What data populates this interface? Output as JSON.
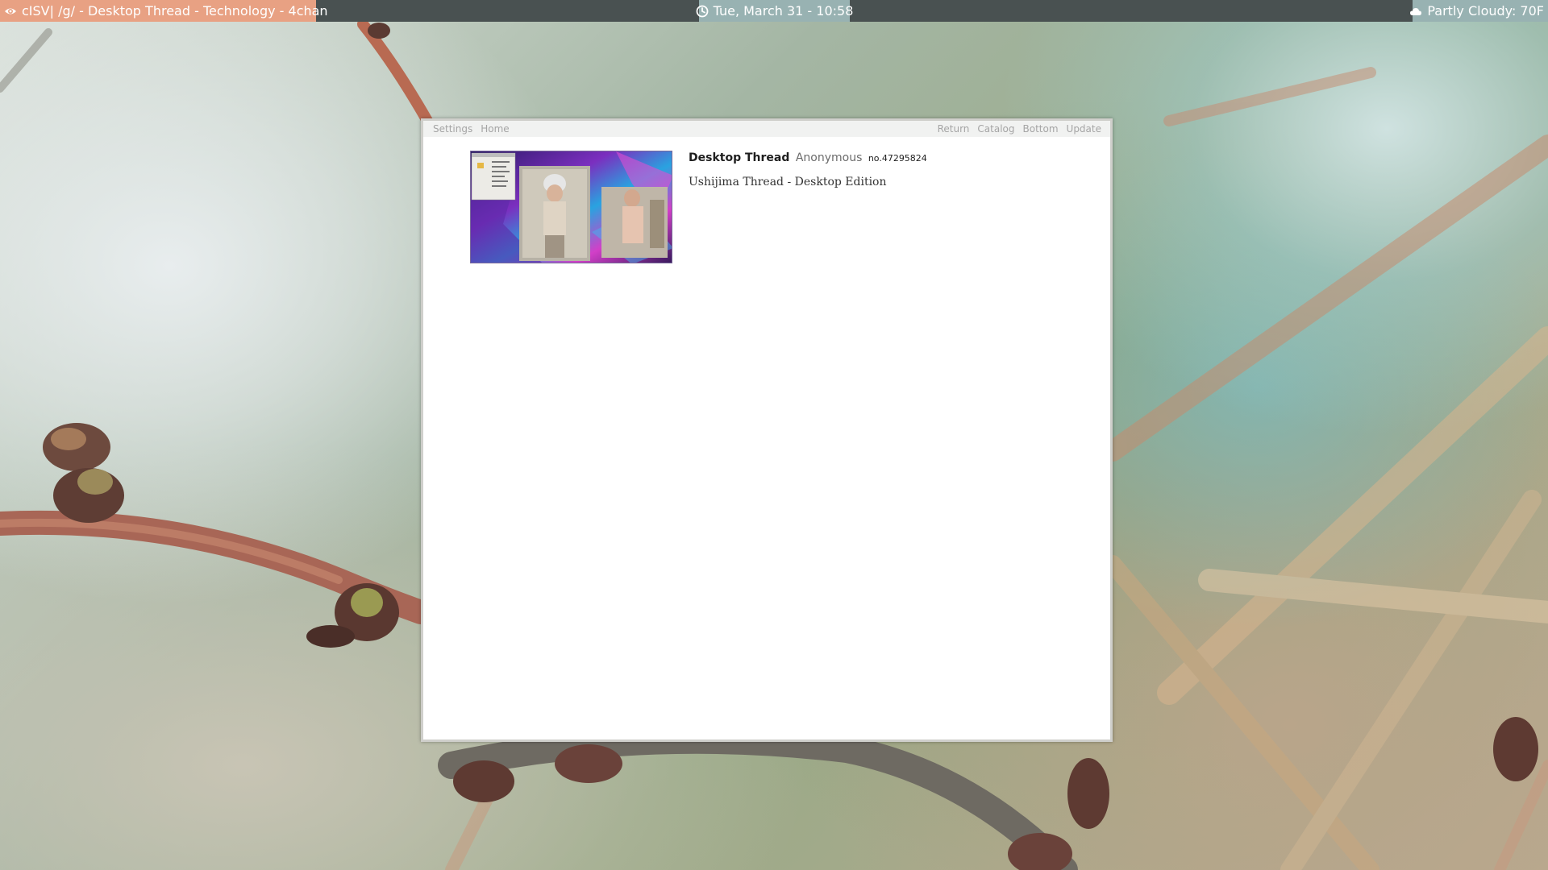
{
  "panel": {
    "window_title": "cISV| /g/ - Desktop Thread - Technology - 4chan",
    "window_icon": "eye-icon",
    "clock": "Tue, March 31 - 10:58",
    "clock_icon": "clock-icon",
    "weather": "Partly Cloudy: 70F",
    "weather_icon": "cloud-icon",
    "colors": {
      "bar": "#495151",
      "window": "#e8a183",
      "accent": "#98b2b2"
    }
  },
  "board_nav": {
    "left": [
      {
        "label": "Settings"
      },
      {
        "label": "Home"
      }
    ],
    "right": [
      {
        "label": "Return"
      },
      {
        "label": "Catalog"
      },
      {
        "label": "Bottom"
      },
      {
        "label": "Update"
      }
    ]
  },
  "thread": {
    "subject": "Desktop Thread",
    "poster": "Anonymous",
    "post_number": "no.47295824",
    "comment": "Ushijima Thread - Desktop Edition",
    "thumbnail": "desktop screenshot thumbnail"
  }
}
